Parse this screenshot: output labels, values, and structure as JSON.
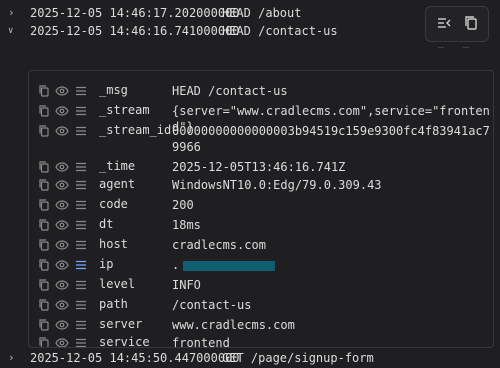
{
  "log_entries": [
    {
      "timestamp": "2025-12-05 14:46:17.202000000",
      "message": "HEAD /about",
      "expanded": false
    },
    {
      "timestamp": "2025-12-05 14:46:16.741000000",
      "message": "HEAD /contact-us",
      "expanded": true
    },
    {
      "timestamp": "2025-12-05 14:45:50.447000000",
      "message": "GET /page/signup-form",
      "expanded": false
    }
  ],
  "toolbar": {
    "wrap_icon": "wrap-lines-icon",
    "copy_icon": "copy-icon"
  },
  "fields": [
    {
      "key": "_msg",
      "value": "HEAD /contact-us"
    },
    {
      "key": "_stream",
      "value": "{server=\"www.cradlecms.com\",service=\"frontend\"}"
    },
    {
      "key": "_stream_id",
      "value": "00000000000000003b94519c159e9300fc4f83941ac79966"
    },
    {
      "key": "_time",
      "value": "2025-12-05T13:46:16.741Z"
    },
    {
      "key": "agent",
      "value": "WindowsNT10.0:Edg/79.0.309.43"
    },
    {
      "key": "code",
      "value": "200"
    },
    {
      "key": "dt",
      "value": "18ms"
    },
    {
      "key": "host",
      "value": "cradlecms.com"
    },
    {
      "key": "ip",
      "value": "."
    },
    {
      "key": "level",
      "value": "INFO"
    },
    {
      "key": "path",
      "value": "/contact-us"
    },
    {
      "key": "server",
      "value": "www.cradlecms.com"
    },
    {
      "key": "service",
      "value": "frontend"
    }
  ],
  "colors": {
    "background": "#1f1f21",
    "text": "#dcdcdc",
    "icon_muted": "#8a8a8a",
    "icon_active": "#6ea8ff",
    "redaction": "#0f5f73"
  }
}
